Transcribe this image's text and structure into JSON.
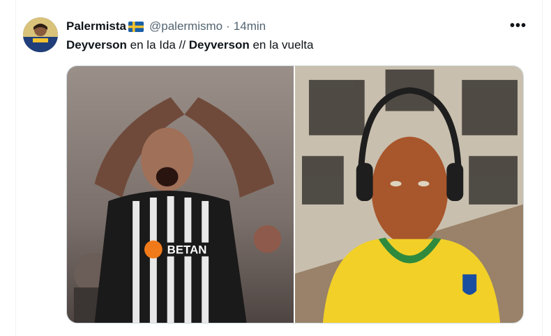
{
  "tweet": {
    "display_name": "Palermista",
    "flag": "Sweden flag",
    "handle": "@palermismo",
    "separator": "·",
    "time": "14min",
    "more_label": "•••",
    "text": {
      "bold1": "Deyverson",
      "part1": " en la Ida // ",
      "bold2": "Deyverson",
      "part2": " en la vuelta"
    },
    "media": [
      {
        "alt": "Player in black and white striped jersey making heart gesture with hands"
      },
      {
        "alt": "Elderly man in yellow Brazil jersey wearing headphones"
      }
    ]
  },
  "colors": {
    "muted": "#536471",
    "text": "#0f1419",
    "border": "#cfd9de"
  }
}
